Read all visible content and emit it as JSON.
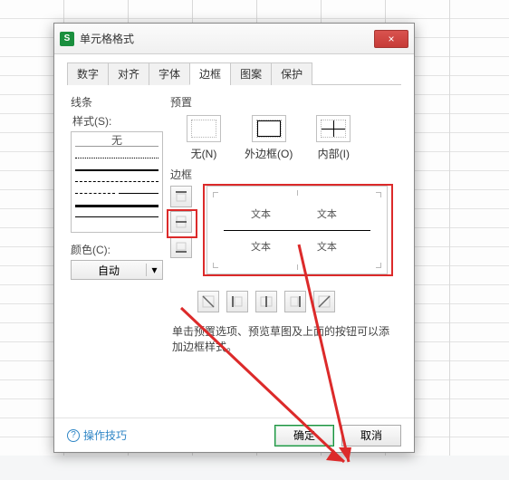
{
  "dialog": {
    "title": "单元格格式",
    "close_icon": "×"
  },
  "tabs": {
    "items": [
      {
        "label": "数字"
      },
      {
        "label": "对齐"
      },
      {
        "label": "字体"
      },
      {
        "label": "边框"
      },
      {
        "label": "图案"
      },
      {
        "label": "保护"
      }
    ],
    "active_index": 3
  },
  "line": {
    "group_label": "线条",
    "style_label": "样式(S):",
    "none_label": "无",
    "color_label": "颜色(C):",
    "color_value": "自动",
    "dropdown_icon": "▾"
  },
  "preset": {
    "group_label": "预置",
    "items": [
      {
        "label": "无(N)"
      },
      {
        "label": "外边框(O)"
      },
      {
        "label": "内部(I)"
      }
    ]
  },
  "border": {
    "group_label": "边框",
    "preview_text": "文本"
  },
  "description": "单击预置选项、预览草图及上面的按钮可以添加边框样式。",
  "footer": {
    "tips_label": "操作技巧",
    "ok_label": "确定",
    "cancel_label": "取消"
  }
}
